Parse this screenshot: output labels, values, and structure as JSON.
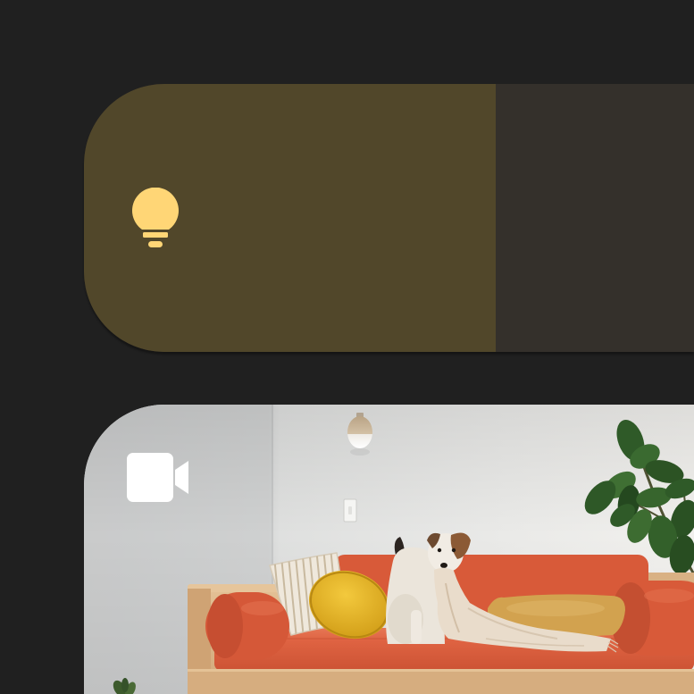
{
  "colors": {
    "background": "#202020"
  },
  "light_tile": {
    "icon": "lightbulb-icon",
    "level": 0.675,
    "colors": {
      "fill": "#51472a",
      "track": "#34302b",
      "icon": "#FFD676"
    }
  },
  "camera_tile": {
    "icon": "videocam-icon",
    "icon_color": "#FFFFFF"
  }
}
